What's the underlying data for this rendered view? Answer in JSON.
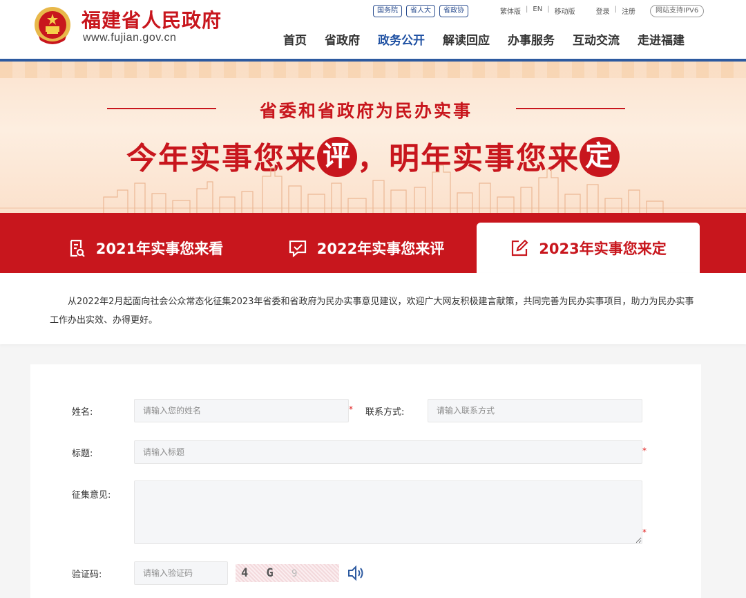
{
  "header": {
    "site_name": "福建省人民政府",
    "site_url": "www.fujian.gov.cn",
    "top_links": [
      "国务院",
      "省人大",
      "省政协"
    ],
    "util_links": {
      "traditional": "繁体版",
      "english": "EN",
      "mobile": "移动版",
      "login": "登录",
      "register": "注册",
      "sep": "|"
    },
    "ipv6_badge": "网站支持IPV6",
    "nav": [
      "首页",
      "省政府",
      "政务公开",
      "解读回应",
      "办事服务",
      "互动交流",
      "走进福建"
    ],
    "nav_active": "政务公开"
  },
  "banner": {
    "subtitle": "省委和省政府为民办实事",
    "title_part1": "今年实事您来",
    "title_seal1": "评",
    "title_part2": "，明年实事您来",
    "title_seal2": "定"
  },
  "tabs": [
    {
      "label": "2021年实事您来看",
      "icon": "document-icon"
    },
    {
      "label": "2022年实事您来评",
      "icon": "chat-check-icon"
    },
    {
      "label": "2023年实事您来定",
      "icon": "edit-icon",
      "active": true
    }
  ],
  "intro": {
    "text": "从2022年2月起面向社会公众常态化征集2023年省委和省政府为民办实事意见建议，欢迎广大网友积极建言献策，共同完善为民办实事项目，助力为民办实事工作办出实效、办得更好。"
  },
  "form": {
    "name_label": "姓名:",
    "name_placeholder": "请输入您的姓名",
    "contact_label": "联系方式:",
    "contact_placeholder": "请输入联系方式",
    "title_label": "标题:",
    "title_placeholder": "请输入标题",
    "opinion_label": "征集意见:",
    "captcha_label": "验证码:",
    "captcha_placeholder": "请输入验证码",
    "captcha_text": "4 G",
    "captcha_faint": "9",
    "required_mark": "*"
  },
  "colors": {
    "brand_red": "#c8161d",
    "nav_blue": "#1e50a2",
    "header_line": "#2d5aa0"
  }
}
